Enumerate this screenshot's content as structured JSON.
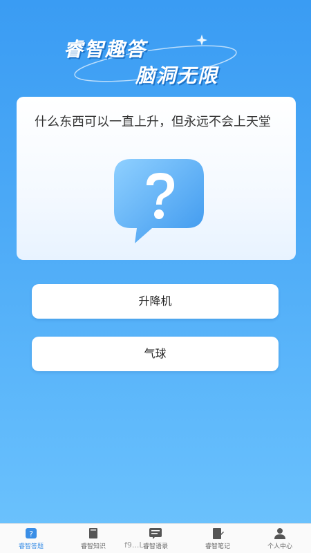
{
  "hero": {
    "title_line1": "睿智趣答",
    "title_line2": "脑洞无限"
  },
  "card": {
    "question": "什么东西可以一直上升，但永远不会上天堂"
  },
  "options": [
    {
      "label": "升降机"
    },
    {
      "label": "气球"
    }
  ],
  "tabbar": {
    "items": [
      {
        "label": "睿智答题",
        "icon": "question-icon",
        "active": true
      },
      {
        "label": "睿智知识",
        "icon": "book-icon",
        "active": false
      },
      {
        "label": "睿智语录",
        "icon": "chat-icon",
        "active": false
      },
      {
        "label": "睿智笔记",
        "icon": "note-icon",
        "active": false
      },
      {
        "label": "个人中心",
        "icon": "person-icon",
        "active": false
      }
    ],
    "active_color": "#3a8ee6",
    "inactive_color": "#666666"
  },
  "watermark": "f9...L",
  "colors": {
    "background_top": "#3a9cf3",
    "background_bottom": "#6dc3fd",
    "bubble": "#4aa3f2"
  }
}
